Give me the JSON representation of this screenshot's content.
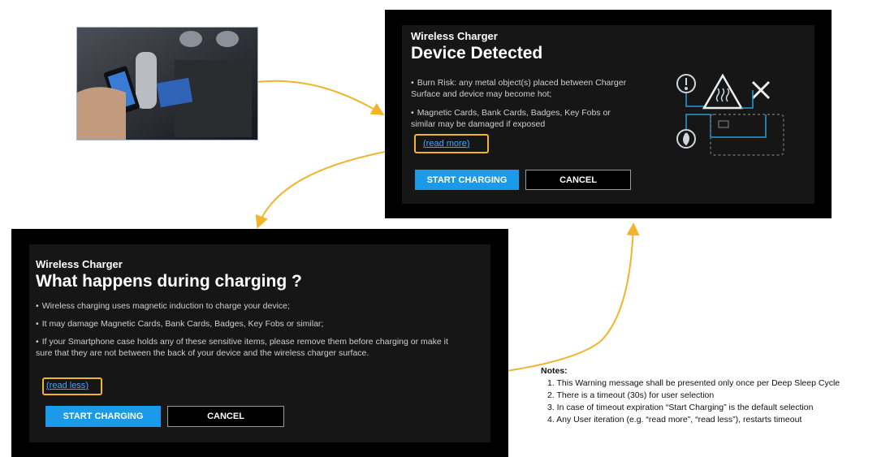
{
  "screen_a": {
    "kicker": "Wireless Charger",
    "title": "Device Detected",
    "bullets": [
      "Burn Risk: any metal object(s) placed between Charger Surface and device may become hot;",
      "Magnetic Cards, Bank Cards, Badges, Key Fobs or similar may be damaged if exposed"
    ],
    "link_open": "(",
    "link_text": "read more",
    "link_close": ")",
    "primary_button": "START CHARGING",
    "secondary_button": "CANCEL"
  },
  "screen_b": {
    "kicker": "Wireless Charger",
    "title": "What happens during charging ?",
    "bullets": [
      "Wireless charging uses magnetic induction to charge your device;",
      "It may damage Magnetic Cards, Bank Cards, Badges, Key Fobs or similar;",
      "If your Smartphone case holds any of these sensitive items, please remove them before charging or make it sure that they are not between the back of your device and the wireless charger surface."
    ],
    "link_open": "(",
    "link_text": "read less",
    "link_close": ")",
    "primary_button": "START CHARGING",
    "secondary_button": "CANCEL"
  },
  "notes": {
    "heading": "Notes:",
    "items": [
      "1. This Warning message shall be presented only once per Deep Sleep Cycle",
      "2. There is a timeout (30s) for user selection",
      "3. In case of timeout expiration “Start Charging” is the default selection",
      "4. Any User iteration (e.g. “read more”, “read less”), restarts timeout"
    ]
  },
  "colors": {
    "accent_blue": "#1a9ae8",
    "link_blue": "#4aa3ff",
    "highlight_orange": "#f1b42a",
    "panel_bg": "#161616"
  },
  "icons": [
    "info-warning-icon",
    "heat-warning-triangle-icon",
    "close-x-icon",
    "fire-icon"
  ]
}
